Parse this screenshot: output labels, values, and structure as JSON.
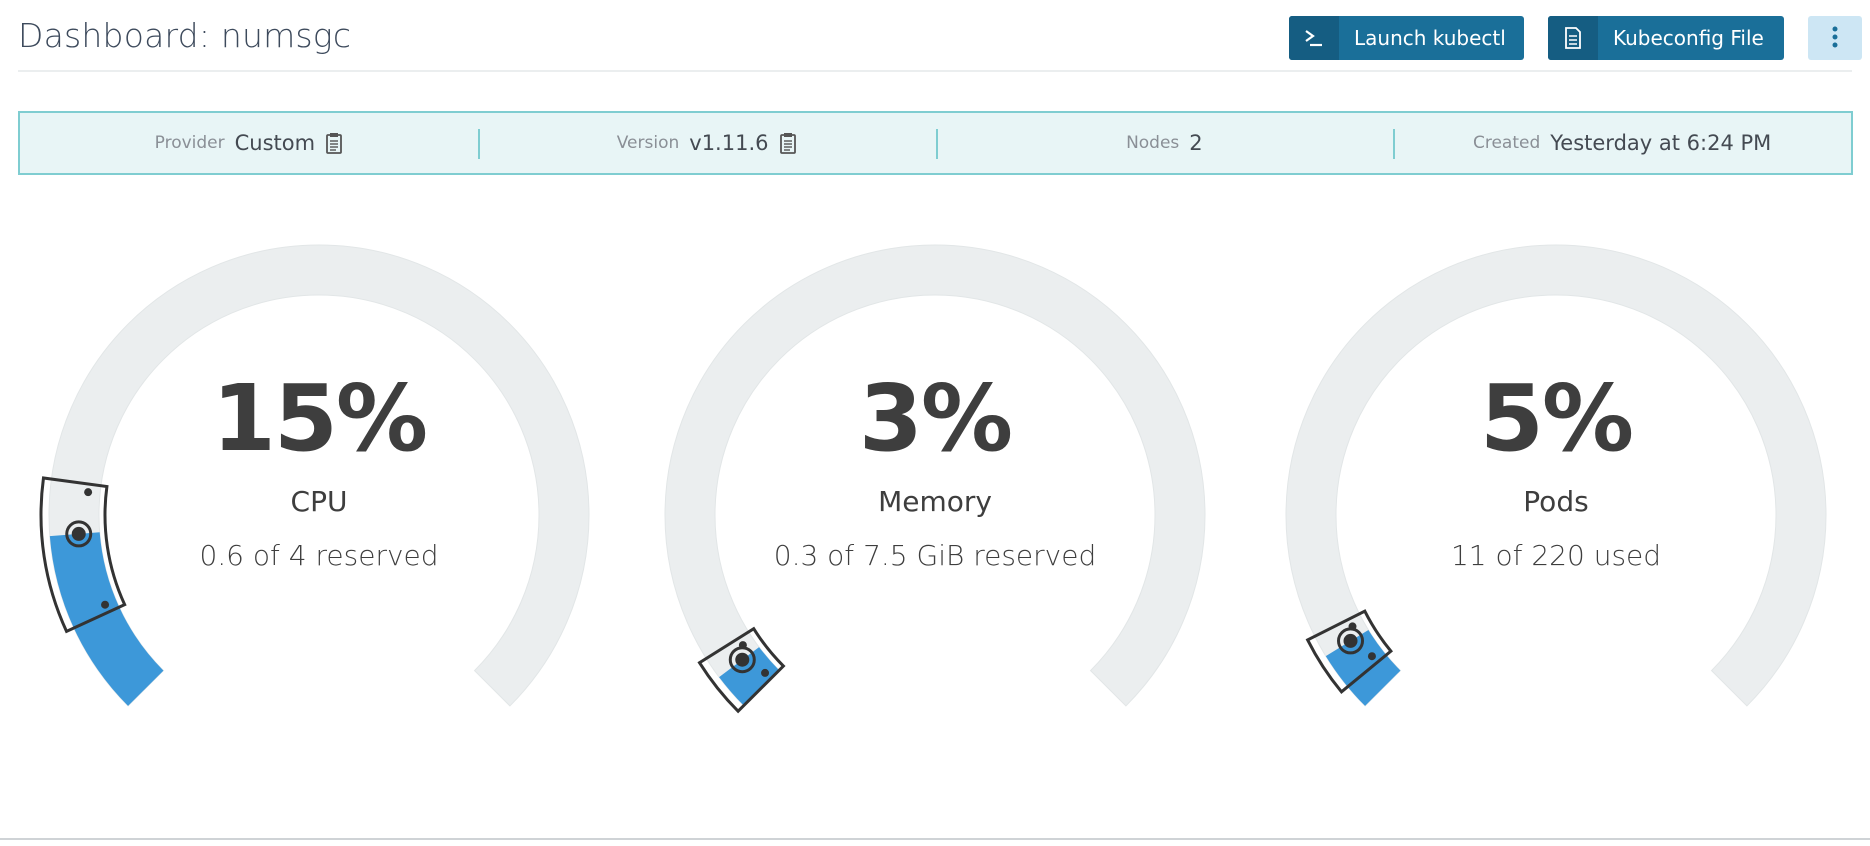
{
  "header": {
    "title": "Dashboard: numsgc",
    "kubectl_label": "Launch kubectl",
    "kubeconfig_label": "Kubeconfig File"
  },
  "info": {
    "provider_label": "Provider",
    "provider_value": "Custom",
    "version_label": "Version",
    "version_value": "v1.11.6",
    "nodes_label": "Nodes",
    "nodes_value": "2",
    "created_label": "Created",
    "created_value": "Yesterday at 6:24 PM"
  },
  "gauges": [
    {
      "id": "cpu",
      "percent_text": "15%",
      "label": "CPU",
      "detail": "0.6 of 4 reserved",
      "fill_fraction": 0.15
    },
    {
      "id": "memory",
      "percent_text": "3%",
      "label": "Memory",
      "detail": "0.3 of 7.5 GiB reserved",
      "fill_fraction": 0.03
    },
    {
      "id": "pods",
      "percent_text": "5%",
      "label": "Pods",
      "detail": "11 of 220 used",
      "fill_fraction": 0.05
    }
  ],
  "colors": {
    "primary_button": "#1a6f99",
    "secondary_button": "#cde6f4",
    "info_bar_bg": "#e8f5f6",
    "info_bar_border": "#7fcdd1",
    "gauge_track": "#ebeeef",
    "gauge_fill": "#3d98d9"
  },
  "icons": {
    "kubectl": "terminal-prompt-icon",
    "kubeconfig": "file-icon",
    "more": "vertical-ellipsis-icon",
    "copy": "clipboard-icon"
  }
}
